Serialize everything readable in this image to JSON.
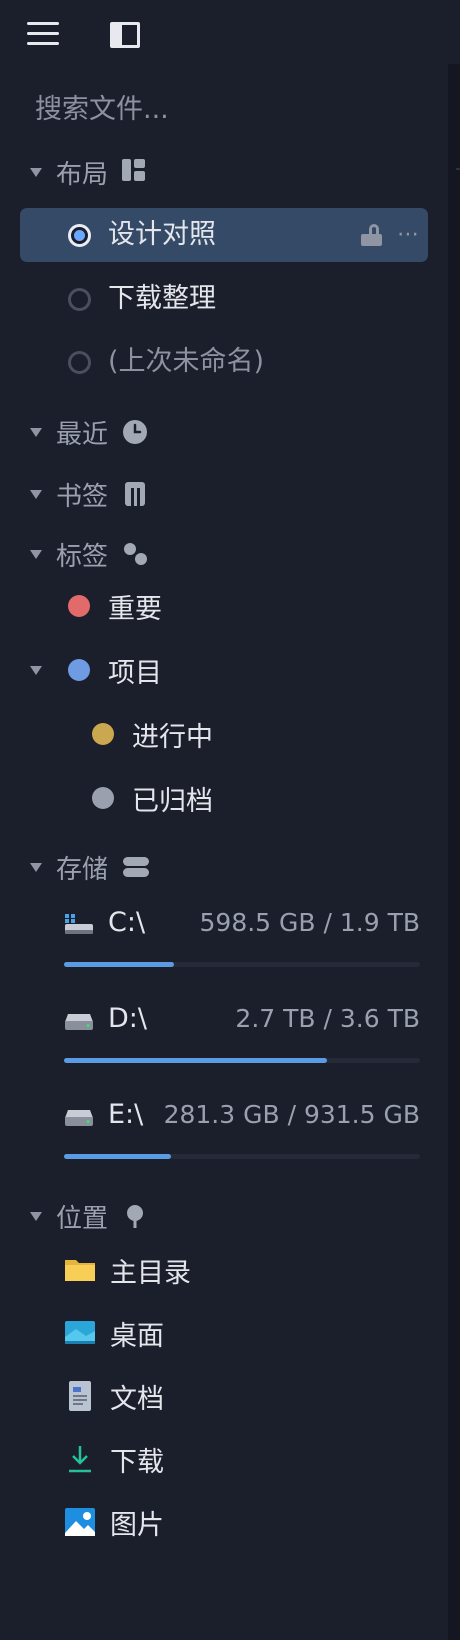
{
  "search": {
    "placeholder": "搜索文件..."
  },
  "sections": {
    "layout": "布局",
    "recent": "最近",
    "bookmarks": "书签",
    "tags": "标签",
    "storage": "存储",
    "places": "位置"
  },
  "layouts": [
    {
      "label": "设计对照",
      "active": true
    },
    {
      "label": "下载整理",
      "active": false
    },
    {
      "label": "(上次未命名)",
      "active": false
    }
  ],
  "tags": [
    {
      "label": "重要",
      "color": "#e26a6a"
    },
    {
      "label": "项目",
      "color": "#6f9be3"
    },
    {
      "label": "进行中",
      "color": "#c9a84f"
    },
    {
      "label": "已归档",
      "color": "#9aa0ae"
    }
  ],
  "drives": [
    {
      "name": "C:\\",
      "usage": "598.5 GB / 1.9 TB",
      "used_fraction": 0.31
    },
    {
      "name": "D:\\",
      "usage": "2.7 TB / 3.6 TB",
      "used_fraction": 0.74
    },
    {
      "name": "E:\\",
      "usage": "281.3 GB / 931.5 GB",
      "used_fraction": 0.3
    }
  ],
  "places": [
    {
      "label": "主目录",
      "icon": "folder-icon"
    },
    {
      "label": "桌面",
      "icon": "desktop-icon"
    },
    {
      "label": "文档",
      "icon": "document-icon"
    },
    {
      "label": "下载",
      "icon": "download-icon"
    },
    {
      "label": "图片",
      "icon": "pictures-icon"
    }
  ],
  "colors": {
    "background": "#1b1e2b",
    "active_row": "#344a66",
    "accent": "#5a9be4"
  }
}
